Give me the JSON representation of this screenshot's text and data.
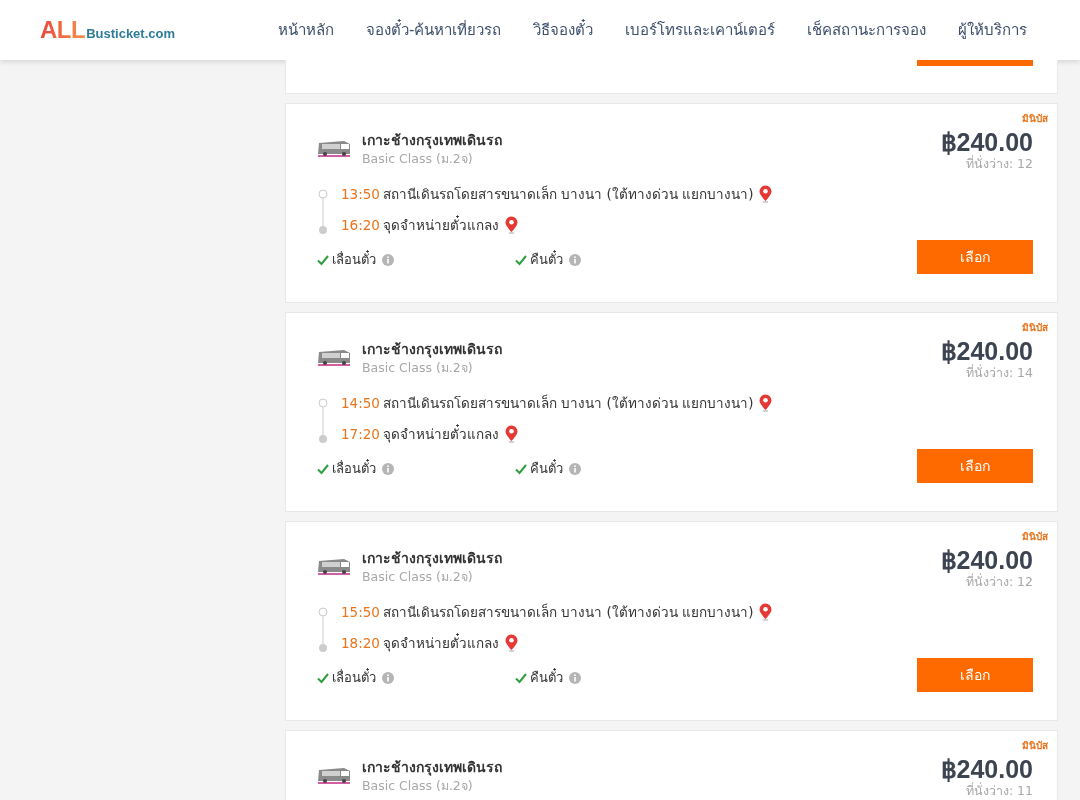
{
  "header": {
    "logo": {
      "brand": "ALL",
      "domain": "Busticket.com"
    },
    "nav": [
      {
        "label": "หน้าหลัก"
      },
      {
        "label": "จองตั๋ว-ค้นหาเที่ยวรถ"
      },
      {
        "label": "วิธีจองตั๋ว"
      },
      {
        "label": "เบอร์โทรและเคาน์เตอร์"
      },
      {
        "label": "เช็คสถานะการจอง"
      },
      {
        "label": "ผู้ให้บริการ"
      }
    ]
  },
  "trips": [
    {
      "kind": "cut_off"
    },
    {
      "kind": "full",
      "badge": "มินิบัส",
      "operator": "เกาะช้างกรุงเทพเดินรถ",
      "class": "Basic Class (ม.2จ)",
      "departure": {
        "time": "13:50",
        "place": "สถานีเดินรถโดยสารขนาดเล็ก บางนา (ใต้ทางด่วน แยกบางนา)"
      },
      "arrival": {
        "time": "16:20",
        "place": "จุดจำหน่ายตั๋วแกลง"
      },
      "features": [
        {
          "label": "เลื่อนตั๋ว",
          "checked": true
        },
        {
          "label": "คืนตั๋ว",
          "checked": true
        }
      ],
      "price": "฿240.00",
      "seats": "ที่นั่งว่าง: 12",
      "button": "เลือก"
    },
    {
      "kind": "full",
      "badge": "มินิบัส",
      "operator": "เกาะช้างกรุงเทพเดินรถ",
      "class": "Basic Class (ม.2จ)",
      "departure": {
        "time": "14:50",
        "place": "สถานีเดินรถโดยสารขนาดเล็ก บางนา (ใต้ทางด่วน แยกบางนา)"
      },
      "arrival": {
        "time": "17:20",
        "place": "จุดจำหน่ายตั๋วแกลง"
      },
      "features": [
        {
          "label": "เลื่อนตั๋ว",
          "checked": true
        },
        {
          "label": "คืนตั๋ว",
          "checked": true
        }
      ],
      "price": "฿240.00",
      "seats": "ที่นั่งว่าง: 14",
      "button": "เลือก"
    },
    {
      "kind": "full",
      "badge": "มินิบัส",
      "operator": "เกาะช้างกรุงเทพเดินรถ",
      "class": "Basic Class (ม.2จ)",
      "departure": {
        "time": "15:50",
        "place": "สถานีเดินรถโดยสารขนาดเล็ก บางนา (ใต้ทางด่วน แยกบางนา)"
      },
      "arrival": {
        "time": "18:20",
        "place": "จุดจำหน่ายตั๋วแกลง"
      },
      "features": [
        {
          "label": "เลื่อนตั๋ว",
          "checked": true
        },
        {
          "label": "คืนตั๋ว",
          "checked": true
        }
      ],
      "price": "฿240.00",
      "seats": "ที่นั่งว่าง: 12",
      "button": "เลือก"
    },
    {
      "kind": "top",
      "badge": "มินิบัส",
      "operator": "เกาะช้างกรุงเทพเดินรถ",
      "class": "Basic Class (ม.2จ)",
      "price": "฿240.00",
      "seats": "ที่นั่งว่าง: 11"
    }
  ]
}
